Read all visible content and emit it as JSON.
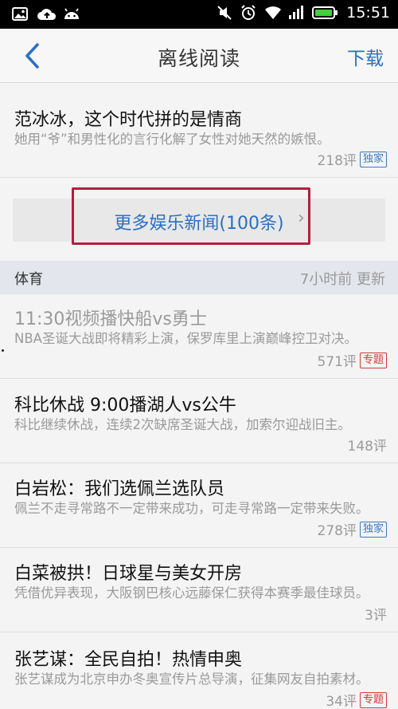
{
  "status_bar": {
    "time": "15:51",
    "left_icons": [
      "image-icon",
      "cloud-upload-icon",
      "android-icon"
    ],
    "right_icons": [
      "mute-icon",
      "alarm-icon",
      "wifi-icon",
      "signal-icon",
      "battery-icon"
    ]
  },
  "header": {
    "back_icon": "chevron-left-icon",
    "title": "离线阅读",
    "action_label": "下载",
    "accent_color": "#2a6fc4"
  },
  "top_item": {
    "title": "范冰冰，这个时代拼的是情商",
    "desc": "她用“爷”和男性化的言行化解了女性对她天然的嫉恨。",
    "comments": "218评",
    "tag": "独家"
  },
  "more_button": {
    "label": "更多娱乐新闻(100条)",
    "chevron": "›"
  },
  "section": {
    "name": "体育",
    "updated": "7小时前 更新"
  },
  "news": [
    {
      "title": "11:30视频播快船vs勇士",
      "desc": "NBA圣诞大战即将精彩上演，保罗库里上演巅峰控卫对决。",
      "comments": "571评",
      "tag": "专题",
      "tag_color": "red",
      "read": true
    },
    {
      "title": "科比休战 9:00播湖人vs公牛",
      "desc": "科比继续休战，连续2次缺席圣诞大战，加索尔迎战旧主。",
      "comments": "148评",
      "tag": "",
      "read": false
    },
    {
      "title": "白岩松：我们选佩兰选队员",
      "desc": "佩兰不走寻常路不一定带来成功，可走寻常路一定带来失败。",
      "comments": "278评",
      "tag": "独家",
      "tag_color": "blue",
      "read": false
    },
    {
      "title": "白菜被拱！日球星与美女开房",
      "desc": "凭借优异表现，大阪钢巴核心远藤保仁获得本赛季最佳球员。",
      "comments": "3评",
      "tag": "",
      "read": false
    },
    {
      "title": "张艺谋：全民自拍！热情申奥",
      "desc": "张艺谋成为北京申办冬奥宣传片总导演，征集网友自拍素材。",
      "comments": "34评",
      "tag": "专题",
      "tag_color": "red",
      "read": false
    }
  ]
}
